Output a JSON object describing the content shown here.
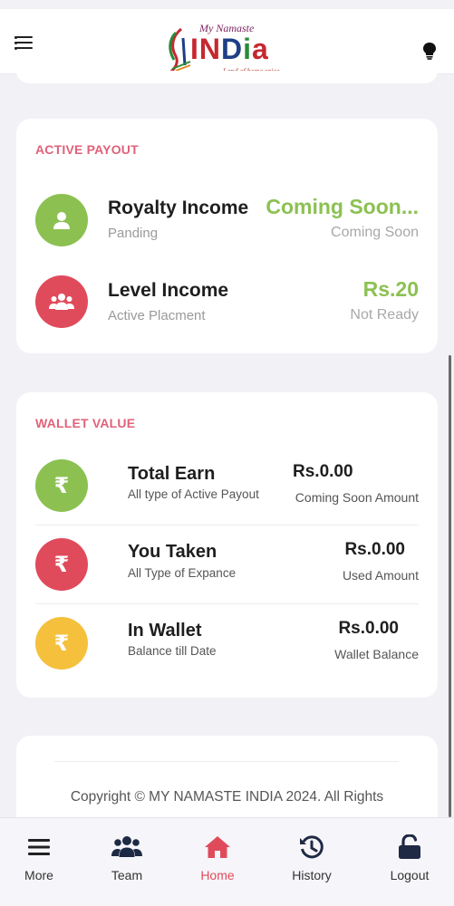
{
  "header": {
    "logo_small": "My Namaste",
    "logo_big_1": "IN",
    "logo_big_2": "D",
    "logo_big_3": "i",
    "logo_big_4": "a",
    "logo_tagline": "Land of home spice..."
  },
  "active_payout": {
    "title": "ACTIVE PAYOUT",
    "items": [
      {
        "title": "Royalty Income",
        "subtitle": "Panding",
        "amount": "Coming Soon...",
        "status": "Coming Soon",
        "icon": "user-icon",
        "color": "#8cc152"
      },
      {
        "title": "Level Income",
        "subtitle": "Active Placment",
        "amount": "Rs.20",
        "status": "Not Ready",
        "icon": "group-icon",
        "color": "#e04b5c"
      }
    ]
  },
  "wallet": {
    "title": "WALLET VALUE",
    "rupee": "₹",
    "items": [
      {
        "title": "Total Earn",
        "subtitle": "All type of Active Payout",
        "amount": "Rs.0.00",
        "note": "Coming Soon Amount",
        "color": "#8cc152"
      },
      {
        "title": "You Taken",
        "subtitle": "All Type of Expance",
        "amount": "Rs.0.00",
        "note": "Used Amount",
        "color": "#e04b5c"
      },
      {
        "title": "In Wallet",
        "subtitle": "Balance till Date",
        "amount": "Rs.0.00",
        "note": "Wallet Balance",
        "color": "#f5c03c"
      }
    ]
  },
  "footer": {
    "copyright": "Copyright © MY NAMASTE INDIA 2024. All Rights"
  },
  "nav": {
    "items": [
      {
        "label": "More",
        "icon": "menu-icon"
      },
      {
        "label": "Team",
        "icon": "team-icon"
      },
      {
        "label": "Home",
        "icon": "home-icon",
        "active": true
      },
      {
        "label": "History",
        "icon": "history-icon"
      },
      {
        "label": "Logout",
        "icon": "unlock-icon"
      }
    ],
    "active_color": "#e04b5c"
  }
}
